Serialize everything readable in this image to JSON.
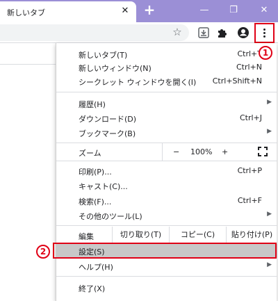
{
  "browser": {
    "tab_title": "新しいタブ",
    "tab_close": "✕",
    "new_tab": "+",
    "window_min": "—",
    "window_max": "❐",
    "window_close": "✕",
    "toolbar": {
      "star": "☆"
    }
  },
  "menu": {
    "items": [
      {
        "label": "新しいタブ(T)",
        "shortcut": "Ctrl+T"
      },
      {
        "label": "新しいウィンドウ(N)",
        "shortcut": "Ctrl+N"
      },
      {
        "label": "シークレット ウィンドウを開く(I)",
        "shortcut": "Ctrl+Shift+N"
      },
      {
        "label": "履歴(H)",
        "arrow": "▶"
      },
      {
        "label": "ダウンロード(D)",
        "shortcut": "Ctrl+J"
      },
      {
        "label": "ブックマーク(B)",
        "arrow": "▶"
      },
      {
        "label": "印刷(P)...",
        "shortcut": "Ctrl+P"
      },
      {
        "label": "キャスト(C)..."
      },
      {
        "label": "検索(F)...",
        "shortcut": "Ctrl+F"
      },
      {
        "label": "その他のツール(L)",
        "arrow": "▶"
      },
      {
        "label": "設定(S)"
      },
      {
        "label": "ヘルプ(H)",
        "arrow": "▶"
      },
      {
        "label": "終了(X)"
      }
    ],
    "zoom": {
      "label": "ズーム",
      "minus": "−",
      "value": "100%",
      "plus": "+"
    },
    "edit": {
      "label": "編集",
      "cut": "切り取り(T)",
      "copy": "コピー(C)",
      "paste": "貼り付け(P)"
    }
  },
  "annotations": {
    "badge1": "1",
    "badge2": "2"
  },
  "colors": {
    "accent_red": "#e00016",
    "titlebar": "#9b8fd6",
    "settings_highlight": "#c8c8c8"
  }
}
